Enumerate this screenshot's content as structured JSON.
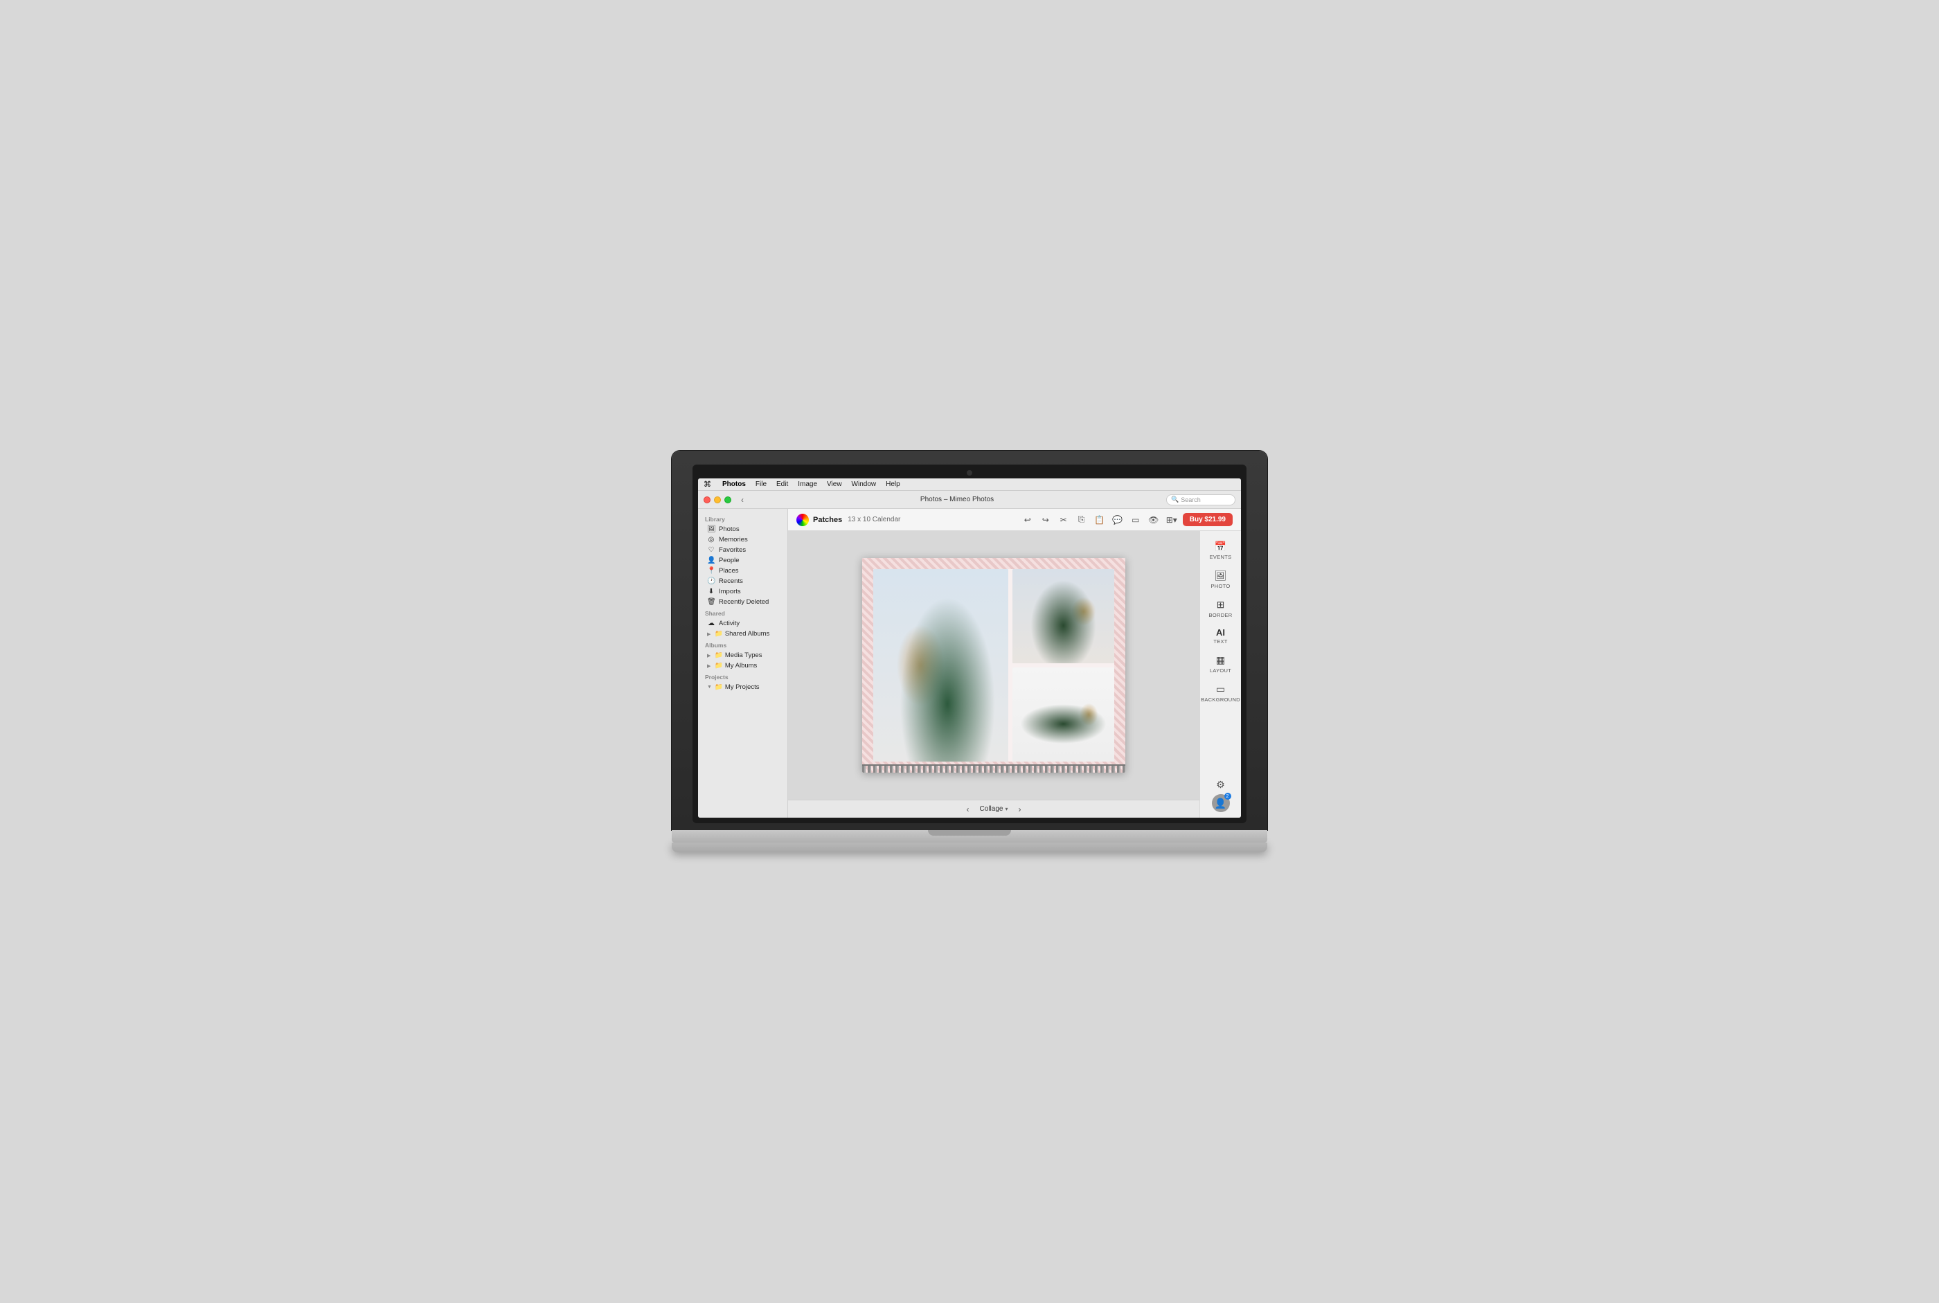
{
  "menubar": {
    "apple": "⌘",
    "app_name": "Photos",
    "items": [
      "File",
      "Edit",
      "Image",
      "View",
      "Window",
      "Help"
    ]
  },
  "titlebar": {
    "title": "Photos – Mimeo Photos",
    "search_placeholder": "Search"
  },
  "toolbar": {
    "product_name": "Patches",
    "product_desc": "13 x 10 Calendar",
    "buy_label": "Buy $21.99"
  },
  "sidebar": {
    "library_label": "Library",
    "shared_label": "Shared",
    "albums_label": "Albums",
    "projects_label": "Projects",
    "items": [
      {
        "id": "photos",
        "icon": "🖼",
        "label": "Photos"
      },
      {
        "id": "memories",
        "icon": "◎",
        "label": "Memories"
      },
      {
        "id": "favorites",
        "icon": "♡",
        "label": "Favorites"
      },
      {
        "id": "people",
        "icon": "👤",
        "label": "People"
      },
      {
        "id": "places",
        "icon": "📍",
        "label": "Places"
      },
      {
        "id": "recents",
        "icon": "🕐",
        "label": "Recents"
      },
      {
        "id": "imports",
        "icon": "⬇",
        "label": "Imports"
      },
      {
        "id": "recently-deleted",
        "icon": "🗑",
        "label": "Recently Deleted"
      }
    ],
    "shared_items": [
      {
        "id": "activity",
        "icon": "☁",
        "label": "Activity"
      },
      {
        "id": "shared-albums",
        "icon": "►",
        "label": "Shared Albums"
      }
    ],
    "album_items": [
      {
        "id": "media-types",
        "icon": "►",
        "label": "Media Types"
      },
      {
        "id": "my-albums",
        "icon": "►",
        "label": "My Albums"
      }
    ],
    "project_items": [
      {
        "id": "my-projects",
        "icon": "▼",
        "label": "My Projects"
      }
    ]
  },
  "right_panel": {
    "items": [
      {
        "id": "events",
        "icon": "📅",
        "label": "EVENTS"
      },
      {
        "id": "photo",
        "icon": "🖼",
        "label": "PHOTO"
      },
      {
        "id": "border",
        "icon": "⊞",
        "label": "BORDER"
      },
      {
        "id": "text",
        "ai_label": "AI TEXT",
        "label": "TEXT"
      },
      {
        "id": "layout",
        "icon": "▦",
        "label": "LAYOUT"
      },
      {
        "id": "background",
        "icon": "▭",
        "label": "BACKGROUND"
      }
    ],
    "settings_icon": "⚙",
    "avatar_badge": "2"
  },
  "bottom_nav": {
    "prev_label": "‹",
    "next_label": "›",
    "page_label": "Collage",
    "dropdown_icon": "▾"
  },
  "collage": {
    "photos": [
      {
        "id": "photo-1",
        "desc": "Woman with dog being kissed, large left"
      },
      {
        "id": "photo-2",
        "desc": "Woman holding dog, top right"
      },
      {
        "id": "photo-3",
        "desc": "Woman lying with dog, bottom right"
      }
    ]
  }
}
